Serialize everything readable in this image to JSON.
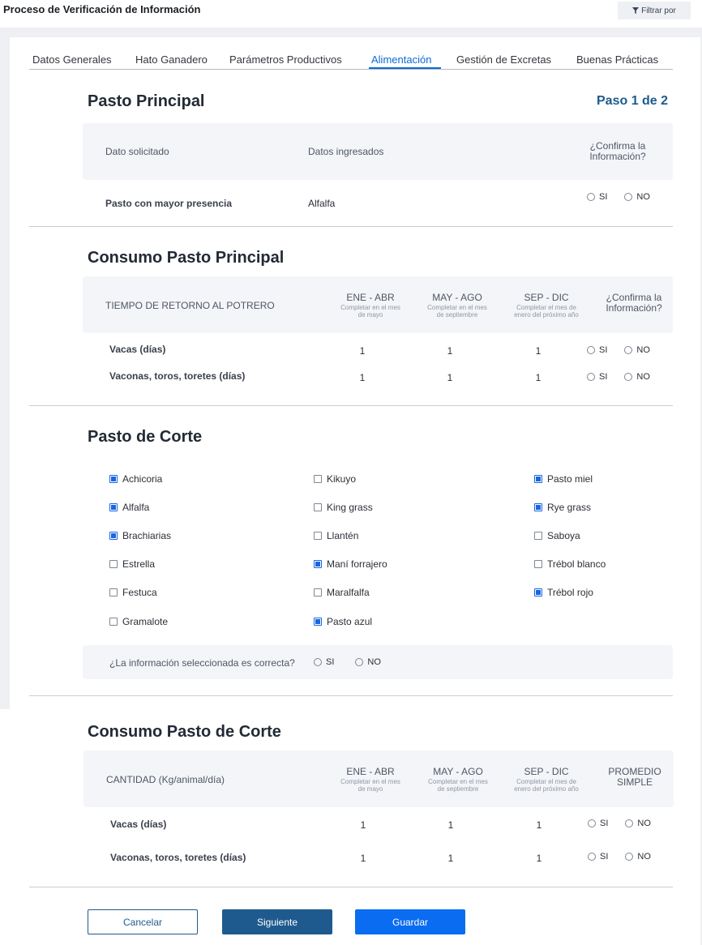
{
  "header": {
    "title": "Proceso de Verificación de Información",
    "filter_label": "Filtrar por"
  },
  "tabs": [
    {
      "label": "Datos Generales"
    },
    {
      "label": "Hato Ganadero"
    },
    {
      "label": "Parámetros Productivos"
    },
    {
      "label": "Alimentación",
      "active": true
    },
    {
      "label": "Gestión de Excretas"
    },
    {
      "label": "Buenas Prácticas"
    }
  ],
  "step_label": "Paso 1 de 2",
  "radio": {
    "yes": "SI",
    "no": "NO"
  },
  "pasto_principal": {
    "title": "Pasto Principal",
    "col_dato": "Dato solicitado",
    "col_ingresados": "Datos ingresados",
    "col_confirma_1": "¿Confirma la",
    "col_confirma_2": "Información?",
    "row_label": "Pasto con mayor presencia",
    "row_value": "Alfalfa"
  },
  "consumo_principal": {
    "title": "Consumo Pasto Principal",
    "col_label": "TIEMPO DE RETORNO AL POTRERO",
    "periods": [
      {
        "name": "ENE - ABR",
        "sub1": "Completar en el mes",
        "sub2": "de mayo"
      },
      {
        "name": "MAY - AGO",
        "sub1": "Completar en el mes",
        "sub2": "de septiembre"
      },
      {
        "name": "SEP - DIC",
        "sub1": "Completar el mes de",
        "sub2": "enero del próximo año"
      }
    ],
    "col_confirma_1": "¿Confirma la",
    "col_confirma_2": "Información?",
    "rows": [
      {
        "label": "Vacas (días)",
        "values": [
          "1",
          "1",
          "1"
        ]
      },
      {
        "label": "Vaconas, toros, toretes (días)",
        "values": [
          "1",
          "1",
          "1"
        ]
      }
    ]
  },
  "pasto_corte": {
    "title": "Pasto de Corte",
    "columns": [
      [
        {
          "label": "Achicoria",
          "checked": true
        },
        {
          "label": "Alfalfa",
          "checked": true
        },
        {
          "label": "Brachiarias",
          "checked": true
        },
        {
          "label": "Estrella",
          "checked": false
        },
        {
          "label": "Festuca",
          "checked": false
        },
        {
          "label": "Gramalote",
          "checked": false
        }
      ],
      [
        {
          "label": "Kikuyo",
          "checked": false
        },
        {
          "label": "King grass",
          "checked": false
        },
        {
          "label": "Llantén",
          "checked": false
        },
        {
          "label": "Maní forrajero",
          "checked": true
        },
        {
          "label": "Maralfalfa",
          "checked": false
        },
        {
          "label": "Pasto azul",
          "checked": true
        }
      ],
      [
        {
          "label": "Pasto miel",
          "checked": true
        },
        {
          "label": "Rye grass",
          "checked": true
        },
        {
          "label": "Saboya",
          "checked": false
        },
        {
          "label": "Trébol blanco",
          "checked": false
        },
        {
          "label": "Trébol rojo",
          "checked": true
        }
      ]
    ],
    "question": "¿La información seleccionada es correcta?"
  },
  "consumo_corte": {
    "title": "Consumo Pasto de Corte",
    "col_label": "CANTIDAD (Kg/animal/día)",
    "periods": [
      {
        "name": "ENE - ABR",
        "sub1": "Completar en el mes",
        "sub2": "de mayo"
      },
      {
        "name": "MAY - AGO",
        "sub1": "Completar en el mes",
        "sub2": "de septiembre"
      },
      {
        "name": "SEP - DIC",
        "sub1": "Completar el mes de",
        "sub2": "enero del próximo año"
      }
    ],
    "col_promedio_1": "PROMEDIO",
    "col_promedio_2": "SIMPLE",
    "rows": [
      {
        "label": "Vacas (días)",
        "values": [
          "1",
          "1",
          "1"
        ]
      },
      {
        "label": "Vaconas, toros, toretes (días)",
        "values": [
          "1",
          "1",
          "1"
        ]
      }
    ]
  },
  "actions": {
    "cancel": "Cancelar",
    "next": "Siguiente",
    "save": "Guardar"
  }
}
